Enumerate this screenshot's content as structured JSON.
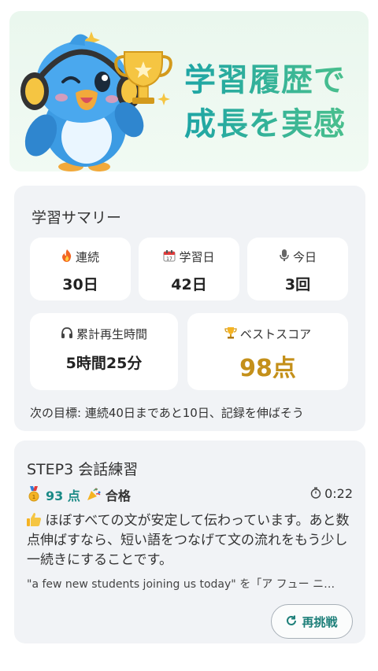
{
  "hero": {
    "title_line1": "学習履歴で",
    "title_line2": "成長を実感",
    "mascot_icon": "bird-mascot-with-trophy-icon"
  },
  "summary": {
    "title": "学習サマリー",
    "stats": [
      {
        "icon": "fire-icon",
        "label": "連続",
        "value": "30日"
      },
      {
        "icon": "calendar-icon",
        "label": "学習日",
        "value": "42日"
      },
      {
        "icon": "microphone-icon",
        "label": "今日",
        "value": "3回"
      },
      {
        "icon": "headphones-icon",
        "label": "累計再生時間",
        "value": "5時間25分"
      },
      {
        "icon": "trophy-icon",
        "label": "ベストスコア",
        "value": "98点"
      }
    ],
    "goal": "次の目標: 連続40日まであと10日、記録を伸ばそう"
  },
  "practice": {
    "title": "STEP3 会話練習",
    "score": "93 点",
    "pass": "合格",
    "timer": "0:22",
    "feedback": "ほぼすべての文が安定して伝わっています。あと数点伸ばすなら、短い語をつなげて文の流れをもう少し一続きにすることです。",
    "sentence": "\"a few new students joining us today\" を「ア フュー ニ…",
    "retry_label": "再挑戦"
  },
  "colors": {
    "accent_teal": "#1a8a86",
    "gold": "#c4901a",
    "hero_gradient_start": "#1ea5a5",
    "hero_gradient_end": "#4fc28a"
  }
}
